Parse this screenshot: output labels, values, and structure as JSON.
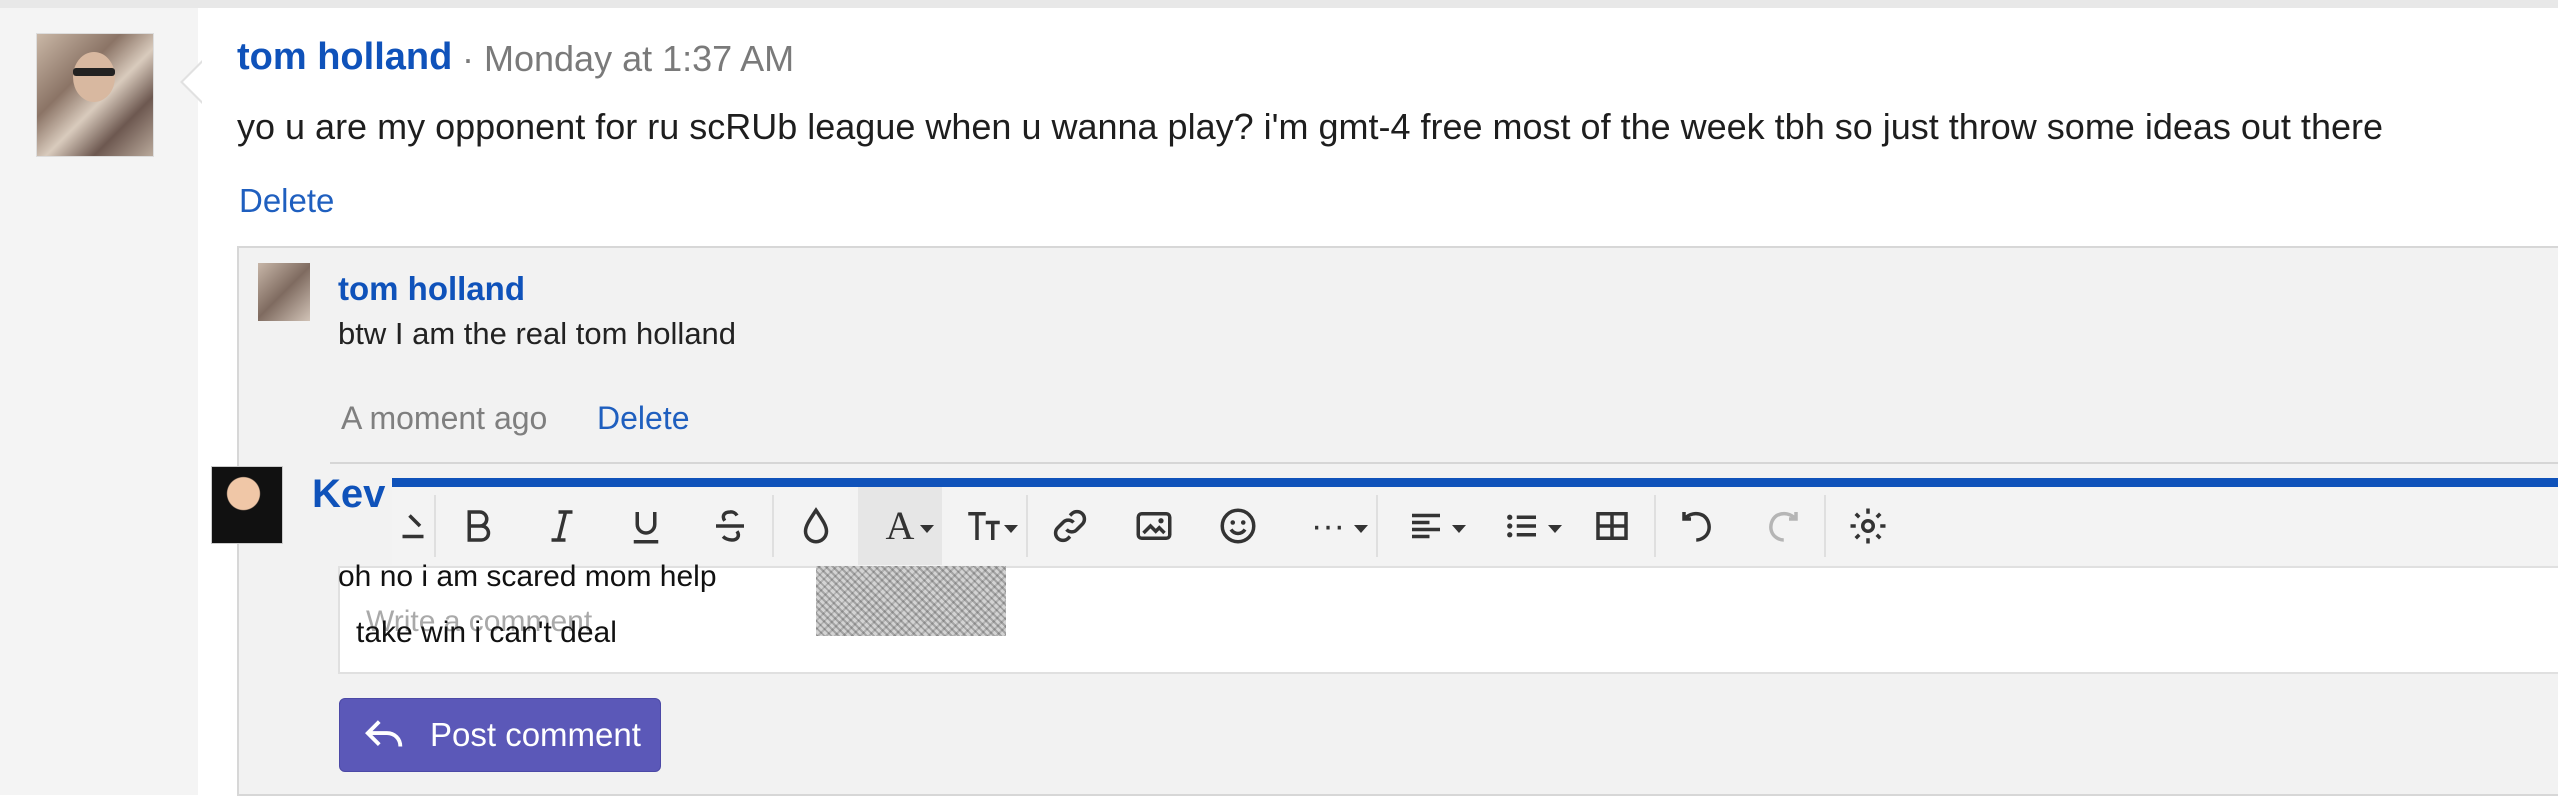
{
  "post": {
    "author": "tom holland",
    "timestamp": "· Monday at 1:37 AM",
    "message": "yo u are my opponent for ru scRUb league when u wanna play? i'm gmt-4 free most of the week tbh so just throw some ideas out there",
    "delete_label": "Delete"
  },
  "reply": {
    "author": "tom holland",
    "text": "btw I am the real tom holland",
    "time": "A moment ago",
    "delete_label": "Delete"
  },
  "composer": {
    "user_name": "Kev",
    "placeholder": "Write a comment",
    "overlay_line1": "oh no i am scared mom help",
    "overlay_line2": "take win i can't deal",
    "post_label": "Post comment"
  },
  "toolbar": {
    "tools": [
      "bold",
      "italic",
      "underline",
      "strikethrough",
      "highlight-color",
      "font-color",
      "font-size",
      "link",
      "image",
      "emoji",
      "more",
      "align",
      "list",
      "table",
      "undo",
      "redo",
      "settings"
    ]
  },
  "colors": {
    "brand_blue": "#0f52ba",
    "link_blue": "#1f5fbf",
    "button_purple": "#5b58b8"
  }
}
